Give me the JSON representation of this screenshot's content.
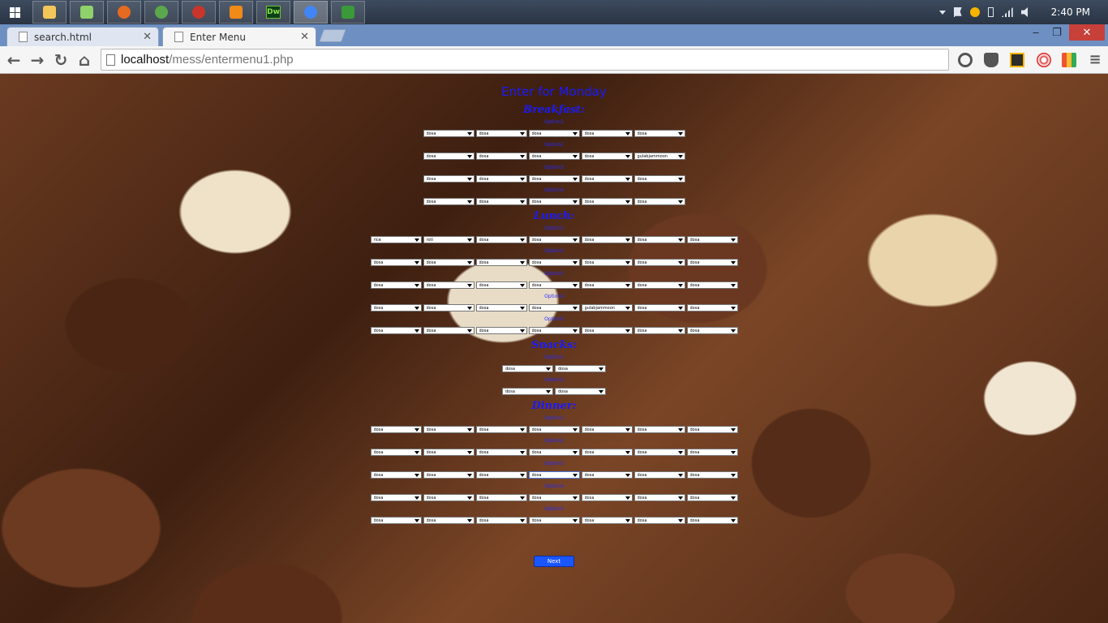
{
  "taskbar": {
    "apps": [
      {
        "icon": "file-explorer-icon",
        "color": "#f3c65a"
      },
      {
        "icon": "photo-viewer-icon",
        "color": "#8fd16a"
      },
      {
        "icon": "firefox-icon",
        "color": "#e66a1f"
      },
      {
        "icon": "globe-icon",
        "color": "#5aa84b"
      },
      {
        "icon": "media-app-icon",
        "color": "#c9352b"
      },
      {
        "icon": "vlc-player-icon",
        "color": "#f08a18"
      },
      {
        "icon": "dreamweaver-icon",
        "color": "#6fbf3a",
        "text": "Dw"
      },
      {
        "icon": "chrome-icon",
        "color": "#4285f4"
      },
      {
        "icon": "network-app-icon",
        "color": "#3a9a3a"
      }
    ],
    "active_index": 7,
    "clock": "2:40 PM"
  },
  "browser": {
    "tabs": [
      {
        "title": "search.html",
        "active": false
      },
      {
        "title": "Enter Menu",
        "active": true
      }
    ],
    "url_host": "localhost",
    "url_path": "/mess/entermenu1.php",
    "window_controls": {
      "minimize": "‒",
      "maximize": "❐",
      "close": "✕"
    }
  },
  "page": {
    "heading": "Enter for Monday",
    "next_label": "Next",
    "accent_color": "#1a1aff",
    "sections": [
      {
        "title": "Breakfast:",
        "options": [
          {
            "label": "Option1",
            "values": [
              "dosa",
              "dosa",
              "dosa",
              "dosa",
              "dosa"
            ]
          },
          {
            "label": "Option2",
            "values": [
              "dosa",
              "dosa",
              "dosa",
              "dosa",
              "gulabjammoon"
            ]
          },
          {
            "label": "Option3",
            "values": [
              "dosa",
              "dosa",
              "dosa",
              "dosa",
              "dosa"
            ]
          },
          {
            "label": "Option4",
            "values": [
              "dosa",
              "dosa",
              "dosa",
              "dosa",
              "dosa"
            ]
          }
        ]
      },
      {
        "title": "Lunch:",
        "options": [
          {
            "label": "Option1",
            "values": [
              "rice",
              "roti",
              "dosa",
              "dosa",
              "dosa",
              "dosa",
              "dosa"
            ]
          },
          {
            "label": "Option2",
            "values": [
              "dosa",
              "dosa",
              "dosa",
              "dosa",
              "dosa",
              "dosa",
              "dosa"
            ]
          },
          {
            "label": "Option3",
            "values": [
              "dosa",
              "dosa",
              "dosa",
              "dosa",
              "dosa",
              "dosa",
              "dosa"
            ]
          },
          {
            "label": "Option4",
            "values": [
              "dosa",
              "dosa",
              "dosa",
              "dosa",
              "gulabjammoon",
              "dosa",
              "dosa"
            ]
          },
          {
            "label": "Option5",
            "values": [
              "dosa",
              "dosa",
              "dosa",
              "dosa",
              "dosa",
              "dosa",
              "dosa"
            ]
          }
        ]
      },
      {
        "title": "Snacks:",
        "options": [
          {
            "label": "Option1",
            "values": [
              "dosa",
              "dosa"
            ]
          },
          {
            "label": "Option2",
            "values": [
              "dosa",
              "dosa"
            ]
          }
        ]
      },
      {
        "title": "Dinner:",
        "options": [
          {
            "label": "Option1",
            "values": [
              "dosa",
              "dosa",
              "dosa",
              "dosa",
              "dosa",
              "dosa",
              "dosa"
            ]
          },
          {
            "label": "Option2",
            "values": [
              "dosa",
              "dosa",
              "dosa",
              "dosa",
              "dosa",
              "dosa",
              "dosa"
            ]
          },
          {
            "label": "Option3",
            "values": [
              "dosa",
              "dosa",
              "dosa",
              "dosa",
              "dosa",
              "dosa",
              "dosa"
            ]
          },
          {
            "label": "Option4",
            "values": [
              "dosa",
              "dosa",
              "dosa",
              "dosa",
              "dosa",
              "dosa",
              "dosa"
            ]
          },
          {
            "label": "Option5",
            "values": [
              "dosa",
              "dosa",
              "dosa",
              "dosa",
              "dosa",
              "dosa",
              "dosa"
            ]
          }
        ]
      }
    ]
  }
}
